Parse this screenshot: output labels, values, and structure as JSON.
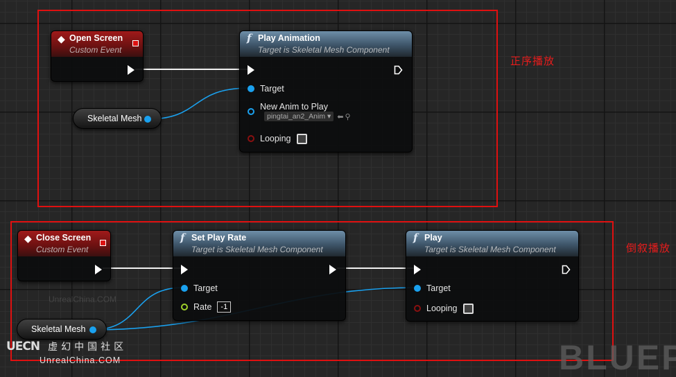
{
  "groups": {
    "top": {
      "label": "正序播放"
    },
    "bottom": {
      "label": "倒叙播放"
    }
  },
  "open_screen": {
    "title": "Open Screen",
    "subtitle": "Custom Event"
  },
  "play_animation": {
    "title": "Play Animation",
    "subtitle": "Target is Skeletal Mesh Component",
    "pins": {
      "target": "Target",
      "new_anim": "New Anim to Play",
      "anim_value": "pingtai_an2_Anim",
      "looping": "Looping"
    }
  },
  "skeletal_mesh_1": {
    "label": "Skeletal Mesh"
  },
  "close_screen": {
    "title": "Close Screen",
    "subtitle": "Custom Event"
  },
  "set_play_rate": {
    "title": "Set Play Rate",
    "subtitle": "Target is Skeletal Mesh Component",
    "pins": {
      "target": "Target",
      "rate": "Rate",
      "rate_value": "-1"
    }
  },
  "play": {
    "title": "Play",
    "subtitle": "Target is Skeletal Mesh Component",
    "pins": {
      "target": "Target",
      "looping": "Looping"
    }
  },
  "skeletal_mesh_2": {
    "label": "Skeletal Mesh"
  },
  "watermark": {
    "brand_mark": "UECN",
    "cn": "虚幻中国社区",
    "en": "UnrealChina.COM",
    "faint": "UnrealChina.COM",
    "corner": "BLUEP"
  },
  "colors": {
    "exec": "#ffffff",
    "object_pin": "#1aa1ef",
    "bool_pin": "#8a1010",
    "float_pin": "#9fd02b",
    "event_header": "#a01a1a",
    "function_header": "#4a6880",
    "annotation": "#e01010"
  }
}
